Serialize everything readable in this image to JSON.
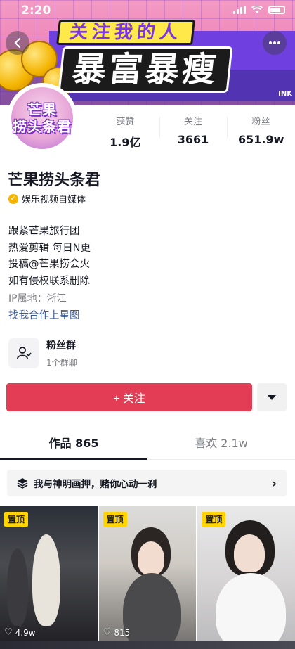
{
  "statusbar": {
    "time": "2:20"
  },
  "banner": {
    "line1": "关注我的人",
    "line2": "暴富暴瘦",
    "tag": "INK"
  },
  "nav": {
    "back_icon": "chevron-left-icon",
    "more_icon": "more-dots-icon"
  },
  "avatar": {
    "line1": "芒果",
    "line2": "捞头条君"
  },
  "stats": [
    {
      "label": "获赞",
      "value": "1.9亿"
    },
    {
      "label": "关注",
      "value": "3661"
    },
    {
      "label": "粉丝",
      "value": "651.9w"
    }
  ],
  "profile": {
    "nickname": "芒果捞头条君",
    "verified_label": "娱乐视频自媒体",
    "bio": [
      "跟紧芒果旅行团",
      "热爱剪辑  每日N更",
      "投稿@芒果捞会火",
      "如有侵权联系删除"
    ],
    "ip": "IP属地：浙江",
    "link": "找我合作上星图"
  },
  "fans_group": {
    "title": "粉丝群",
    "subtitle": "1个群聊"
  },
  "follow": {
    "label": "+ 关注"
  },
  "tabs": [
    {
      "label": "作品 865",
      "active": true
    },
    {
      "label": "喜欢 2.1w",
      "active": false
    }
  ],
  "collection": {
    "text": "我与神明画押，赌你心动一刹"
  },
  "grid": [
    {
      "pin": "置顶",
      "likes": "4.9w"
    },
    {
      "pin": "置顶",
      "likes": "815"
    },
    {
      "pin": "置顶",
      "likes": ""
    }
  ],
  "colors": {
    "accent": "#e33c55",
    "link": "#3b5b9a",
    "pin": "#ffd400",
    "verify": "#f5b400"
  }
}
